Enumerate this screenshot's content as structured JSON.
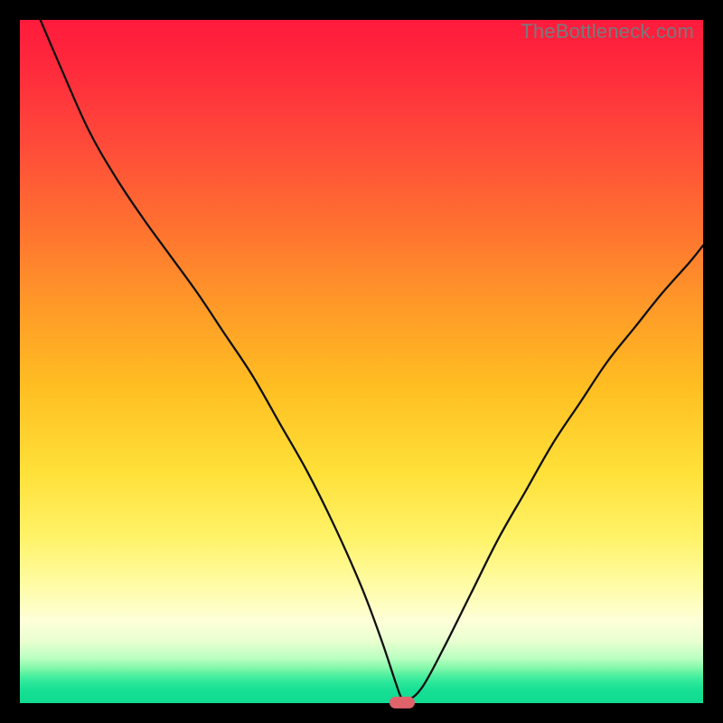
{
  "watermark": "TheBottleneck.com",
  "colors": {
    "frame_bg": "#000000",
    "curve_stroke": "#101010",
    "marker_fill": "#e0636b"
  },
  "chart_data": {
    "type": "line",
    "title": "",
    "xlabel": "",
    "ylabel": "",
    "xlim": [
      0,
      100
    ],
    "ylim": [
      0,
      100
    ],
    "grid": false,
    "legend": false,
    "marker": {
      "x": 56,
      "y": 0
    },
    "series": [
      {
        "name": "bottleneck-curve",
        "x": [
          3,
          6,
          10,
          14,
          18,
          22,
          26,
          30,
          34,
          38,
          42,
          46,
          50,
          53,
          55,
          56,
          57,
          59,
          62,
          66,
          70,
          74,
          78,
          82,
          86,
          90,
          94,
          98,
          100
        ],
        "y": [
          100,
          93,
          84,
          77,
          71,
          65.5,
          60,
          54,
          48,
          41,
          34,
          26,
          17,
          9,
          3,
          0.5,
          0.5,
          2.5,
          8,
          16,
          24,
          31,
          38,
          44,
          50,
          55,
          60,
          64.5,
          67
        ]
      }
    ],
    "annotations": []
  }
}
